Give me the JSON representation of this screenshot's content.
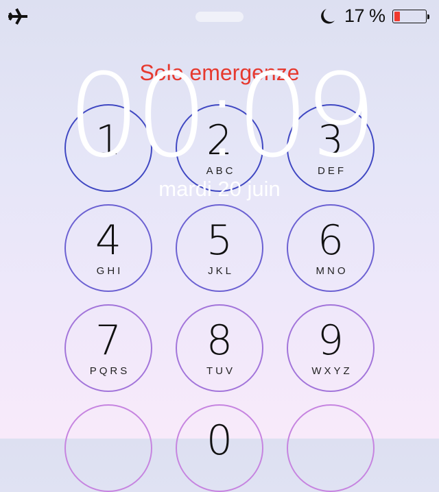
{
  "status_bar": {
    "airplane_icon": "airplane-icon",
    "moon_icon": "moon-icon",
    "battery_percent_text": "17 %",
    "battery_level": 0.17,
    "battery_color": "#f03a2e"
  },
  "lock": {
    "emergency_label": "Solo emergenze",
    "time": "00:09",
    "date": "mardi 20 juin"
  },
  "keypad": {
    "keys": [
      {
        "digit": "1",
        "letters": ""
      },
      {
        "digit": "2",
        "letters": "ABC"
      },
      {
        "digit": "3",
        "letters": "DEF"
      },
      {
        "digit": "4",
        "letters": "GHI"
      },
      {
        "digit": "5",
        "letters": "JKL"
      },
      {
        "digit": "6",
        "letters": "MNO"
      },
      {
        "digit": "7",
        "letters": "PQRS"
      },
      {
        "digit": "8",
        "letters": "TUV"
      },
      {
        "digit": "9",
        "letters": "WXYZ"
      },
      {
        "digit": "",
        "letters": ""
      },
      {
        "digit": "0",
        "letters": ""
      },
      {
        "digit": "",
        "letters": ""
      }
    ],
    "row_colors": [
      "#3f47c2",
      "#6b60d2",
      "#a274da",
      "#c684e0"
    ]
  }
}
